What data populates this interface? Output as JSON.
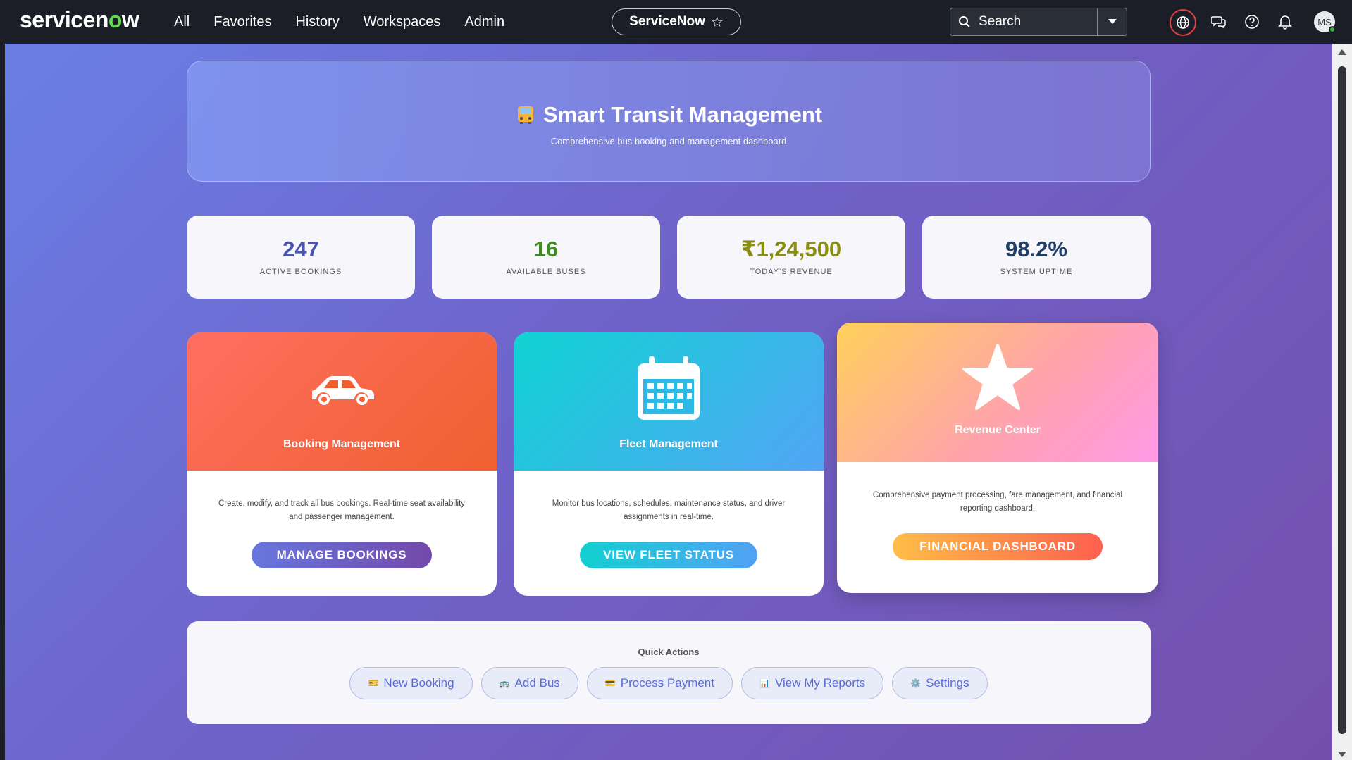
{
  "topnav": {
    "logo_prefix": "servicen",
    "logo_o": "o",
    "logo_suffix": "w",
    "links": [
      "All",
      "Favorites",
      "History",
      "Workspaces",
      "Admin"
    ],
    "instance": "ServiceNow",
    "search_placeholder": "Search",
    "avatar_initials": "MS"
  },
  "hero": {
    "title": "Smart Transit Management",
    "subtitle": "Comprehensive bus booking and management dashboard"
  },
  "stats": [
    {
      "value": "247",
      "label": "ACTIVE BOOKINGS",
      "color": "#4954b5"
    },
    {
      "value": "16",
      "label": "AVAILABLE BUSES",
      "color": "#3e8e1e"
    },
    {
      "value": "₹1,24,500",
      "label": "TODAY'S REVENUE",
      "color": "#8a8d0d"
    },
    {
      "value": "98.2%",
      "label": "SYSTEM UPTIME",
      "color": "#1f3f6a"
    }
  ],
  "cards": [
    {
      "icon": "car-icon",
      "title": "Booking Management",
      "description": "Create, modify, and track all bus bookings. Real-time seat availability and passenger management.",
      "button": "MANAGE BOOKINGS"
    },
    {
      "icon": "calendar-icon",
      "title": "Fleet Management",
      "description": "Monitor bus locations, schedules, maintenance status, and driver assignments in real-time.",
      "button": "VIEW FLEET STATUS"
    },
    {
      "icon": "star-icon",
      "title": "Revenue Center",
      "description": "Comprehensive payment processing, fare management, and financial reporting dashboard.",
      "button": "FINANCIAL DASHBOARD"
    }
  ],
  "quick_actions": {
    "title": "Quick Actions",
    "buttons": [
      {
        "icon": "🎫",
        "label": "New Booking"
      },
      {
        "icon": "🚌",
        "label": "Add Bus"
      },
      {
        "icon": "💳",
        "label": "Process Payment"
      },
      {
        "icon": "📊",
        "label": "View My Reports"
      },
      {
        "icon": "⚙️",
        "label": "Settings"
      }
    ]
  }
}
